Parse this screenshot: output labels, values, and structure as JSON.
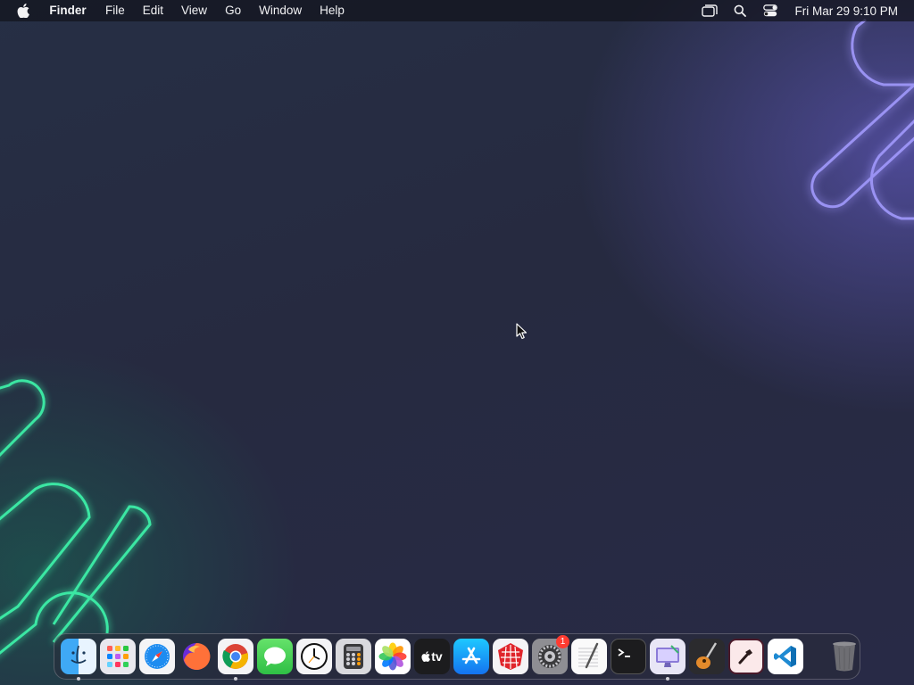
{
  "menubar": {
    "app_name": "Finder",
    "menus": [
      "File",
      "Edit",
      "View",
      "Go",
      "Window",
      "Help"
    ],
    "clock": "Fri Mar 29  9:10 PM",
    "status_icons": [
      "window-icon",
      "search-icon",
      "control-center-icon"
    ]
  },
  "dock": {
    "apps": [
      {
        "name": "finder",
        "running": true
      },
      {
        "name": "launchpad",
        "running": false
      },
      {
        "name": "safari",
        "running": false
      },
      {
        "name": "firefox",
        "running": false
      },
      {
        "name": "chrome",
        "running": true
      },
      {
        "name": "messages",
        "running": false
      },
      {
        "name": "clock",
        "running": false
      },
      {
        "name": "calculator",
        "running": false
      },
      {
        "name": "photos",
        "running": false
      },
      {
        "name": "apple-tv",
        "running": false,
        "label": "tv"
      },
      {
        "name": "app-store",
        "running": false
      },
      {
        "name": "redshift-app",
        "running": false
      },
      {
        "name": "system-settings",
        "running": false,
        "badge": "1"
      },
      {
        "name": "textedit",
        "running": false
      },
      {
        "name": "terminal",
        "running": false
      },
      {
        "name": "screen-sharing",
        "running": true
      },
      {
        "name": "garageband",
        "running": false
      },
      {
        "name": "pencil-app",
        "running": false
      },
      {
        "name": "vscode",
        "running": false
      },
      {
        "name": "trash",
        "running": false
      }
    ]
  },
  "colors": {
    "neon_green": "#2ee89a",
    "neon_purple": "#9d95ff",
    "menubar_text": "#f2f2f4"
  }
}
